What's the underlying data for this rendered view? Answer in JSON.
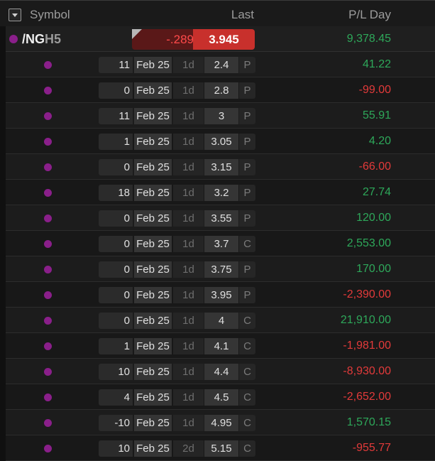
{
  "header": {
    "symbol_label": "Symbol",
    "last_label": "Last",
    "pl_label": "P/L Day"
  },
  "main": {
    "symbol_main": "/NG",
    "symbol_suffix": "H5",
    "change": "-.289",
    "last": "3.945",
    "pl_day": "9,378.45"
  },
  "colors": {
    "positive": "#2ea85a",
    "negative": "#e23a3a",
    "dot": "#8a1f8a",
    "last_bg": "#c8302c"
  },
  "rows": [
    {
      "qty": "11",
      "exp": "Feb 25",
      "dte": "1d",
      "strike": "2.4",
      "type": "P",
      "pl": "41.22"
    },
    {
      "qty": "0",
      "exp": "Feb 25",
      "dte": "1d",
      "strike": "2.8",
      "type": "P",
      "pl": "-99.00"
    },
    {
      "qty": "11",
      "exp": "Feb 25",
      "dte": "1d",
      "strike": "3",
      "type": "P",
      "pl": "55.91"
    },
    {
      "qty": "1",
      "exp": "Feb 25",
      "dte": "1d",
      "strike": "3.05",
      "type": "P",
      "pl": "4.20"
    },
    {
      "qty": "0",
      "exp": "Feb 25",
      "dte": "1d",
      "strike": "3.15",
      "type": "P",
      "pl": "-66.00"
    },
    {
      "qty": "18",
      "exp": "Feb 25",
      "dte": "1d",
      "strike": "3.2",
      "type": "P",
      "pl": "27.74"
    },
    {
      "qty": "0",
      "exp": "Feb 25",
      "dte": "1d",
      "strike": "3.55",
      "type": "P",
      "pl": "120.00"
    },
    {
      "qty": "0",
      "exp": "Feb 25",
      "dte": "1d",
      "strike": "3.7",
      "type": "C",
      "pl": "2,553.00"
    },
    {
      "qty": "0",
      "exp": "Feb 25",
      "dte": "1d",
      "strike": "3.75",
      "type": "P",
      "pl": "170.00"
    },
    {
      "qty": "0",
      "exp": "Feb 25",
      "dte": "1d",
      "strike": "3.95",
      "type": "P",
      "pl": "-2,390.00"
    },
    {
      "qty": "0",
      "exp": "Feb 25",
      "dte": "1d",
      "strike": "4",
      "type": "C",
      "pl": "21,910.00"
    },
    {
      "qty": "1",
      "exp": "Feb 25",
      "dte": "1d",
      "strike": "4.1",
      "type": "C",
      "pl": "-1,981.00"
    },
    {
      "qty": "10",
      "exp": "Feb 25",
      "dte": "1d",
      "strike": "4.4",
      "type": "C",
      "pl": "-8,930.00"
    },
    {
      "qty": "4",
      "exp": "Feb 25",
      "dte": "1d",
      "strike": "4.5",
      "type": "C",
      "pl": "-2,652.00"
    },
    {
      "qty": "-10",
      "exp": "Feb 25",
      "dte": "1d",
      "strike": "4.95",
      "type": "C",
      "pl": "1,570.15"
    },
    {
      "qty": "10",
      "exp": "Feb 25",
      "dte": "2d",
      "strike": "5.15",
      "type": "C",
      "pl": "-955.77"
    }
  ]
}
